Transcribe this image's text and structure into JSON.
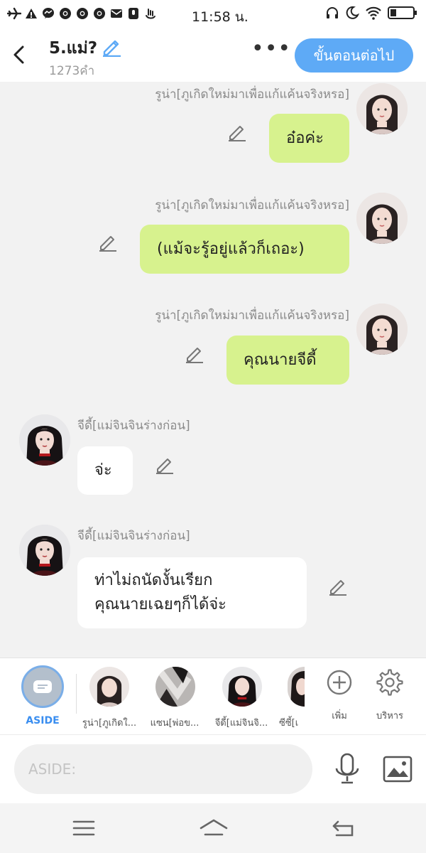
{
  "status_bar": {
    "time": "11:58 น.",
    "left_icons": [
      "airplane-icon",
      "warning-icon",
      "messenger-icon",
      "chrome-icon",
      "chrome-icon",
      "chrome-icon",
      "mail-icon",
      "voice-icon",
      "gesture-icon"
    ],
    "right_icons": [
      "headphones-icon",
      "moon-icon",
      "wifi-icon",
      "battery-icon"
    ]
  },
  "header": {
    "title": "5.แม่?",
    "word_count": "1273คำ",
    "more_label": "•••",
    "next_button": "ขั้นตอนต่อไป"
  },
  "messages": [
    {
      "side": "right",
      "sender": "รูน่า[ภูเกิดใหม่มาเพื่อแก้แค้นจริงหรอ]",
      "lines": [
        "อ๋อค่ะ"
      ],
      "bubble_color": "#d7f28e"
    },
    {
      "side": "right",
      "sender": "รูน่า[ภูเกิดใหม่มาเพื่อแก้แค้นจริงหรอ]",
      "lines": [
        "(แม้จะรู้อยู่แล้วก็เถอะ)"
      ],
      "bubble_color": "#d7f28e"
    },
    {
      "side": "right",
      "sender": "รูน่า[ภูเกิดใหม่มาเพื่อแก้แค้นจริงหรอ]",
      "lines": [
        "คุณนายจีดี้"
      ],
      "bubble_color": "#d7f28e"
    },
    {
      "side": "left",
      "sender": "จีดี้[แม่จินจินร่างก่อน]",
      "lines": [
        "จ่ะ"
      ],
      "bubble_color": "#ffffff"
    },
    {
      "side": "left",
      "sender": "จีดี้[แม่จินจินร่างก่อน]",
      "lines": [
        "ท่าไม่ถนัดงั้นเรียก",
        "คุณนายเฉยๆก็ได้จ่ะ"
      ],
      "bubble_color": "#ffffff"
    }
  ],
  "cast_bar": {
    "aside_label": "ASIDE",
    "characters": [
      {
        "label": "รูน่า[ภูเกิดใ..."
      },
      {
        "label": "แซน[พ่อข..."
      },
      {
        "label": "จีดี้[แม่จินจิ..."
      },
      {
        "label": "ซีซี้[เ"
      }
    ],
    "add_label": "เพิ่ม",
    "manage_label": "บริหาร"
  },
  "input": {
    "placeholder": "ASIDE:",
    "value": ""
  },
  "nav": {
    "icons": [
      "menu-icon",
      "home-icon",
      "back-icon"
    ]
  },
  "colors": {
    "accent": "#5eaaf6",
    "green_bubble": "#d7f28e",
    "aside_blue": "#3a8ef0"
  }
}
